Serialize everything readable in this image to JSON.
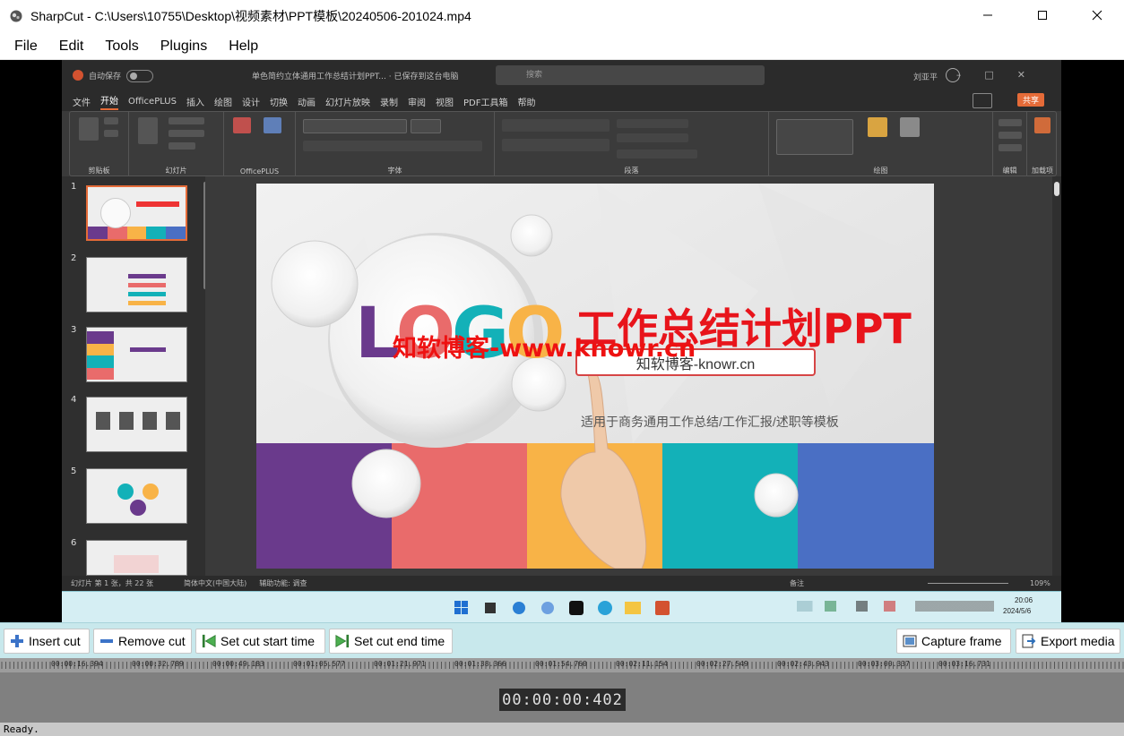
{
  "window": {
    "title": "SharpCut - C:\\Users\\10755\\Desktop\\视频素材\\PPT模板\\20240506-201024.mp4",
    "app_icon": "sharpcut-logo-icon",
    "controls": {
      "minimize": "minimize-icon",
      "maximize": "maximize-icon",
      "close": "close-icon"
    }
  },
  "menu": [
    "File",
    "Edit",
    "Tools",
    "Plugins",
    "Help"
  ],
  "video_frame": {
    "ppt": {
      "autosave": "自动保存",
      "doc_title": "单色简约立体通用工作总结计划PPT... · 已保存到这台电脑",
      "search": "搜索",
      "user": "刘亚平",
      "tabs": [
        "文件",
        "开始",
        "OfficePLUS",
        "插入",
        "绘图",
        "设计",
        "切换",
        "动画",
        "幻灯片放映",
        "录制",
        "审阅",
        "视图",
        "PDF工具箱",
        "帮助"
      ],
      "active_tab": "开始",
      "share": "共享",
      "ribbon_groups": [
        "剪贴板",
        "幻灯片",
        "OfficePLUS",
        "字体",
        "段落",
        "绘图",
        "编辑",
        "加载项"
      ],
      "slide_numbers": [
        "1",
        "2",
        "3",
        "4",
        "5",
        "6"
      ],
      "slide": {
        "logo": [
          "L",
          "O",
          "G",
          "O"
        ],
        "title": "工作总结计划PPT",
        "watermark": "知软博客-www.knowr.cn",
        "box_text": "知软博客-knowr.cn",
        "subtitle": "适用于商务通用工作总结/工作汇报/述职等模板"
      },
      "status_left": "幻灯片 第 1 张，共 22 张",
      "status_lang": "简体中文(中国大陆)",
      "status_access": "辅助功能: 调查",
      "status_notes": "备注",
      "zoom": "109%",
      "taskbar_time": "20:06",
      "taskbar_date": "2024/5/6"
    }
  },
  "toolbar": {
    "insert_cut": "Insert cut",
    "remove_cut": "Remove cut",
    "set_start": "Set cut start time",
    "set_end": "Set cut end time",
    "capture": "Capture frame",
    "export": "Export media"
  },
  "timeline": {
    "labels": [
      "00:00:16.394",
      "00:00:32.789",
      "00:00:49.183",
      "00:01:05.577",
      "00:01:21.971",
      "00:01:38.366",
      "00:01:54.760",
      "00:02:11.154",
      "00:02:27.549",
      "00:02:43.943",
      "00:03:00.337",
      "00:03:16.731"
    ]
  },
  "timecode": "00:00:00:402",
  "status": "Ready."
}
